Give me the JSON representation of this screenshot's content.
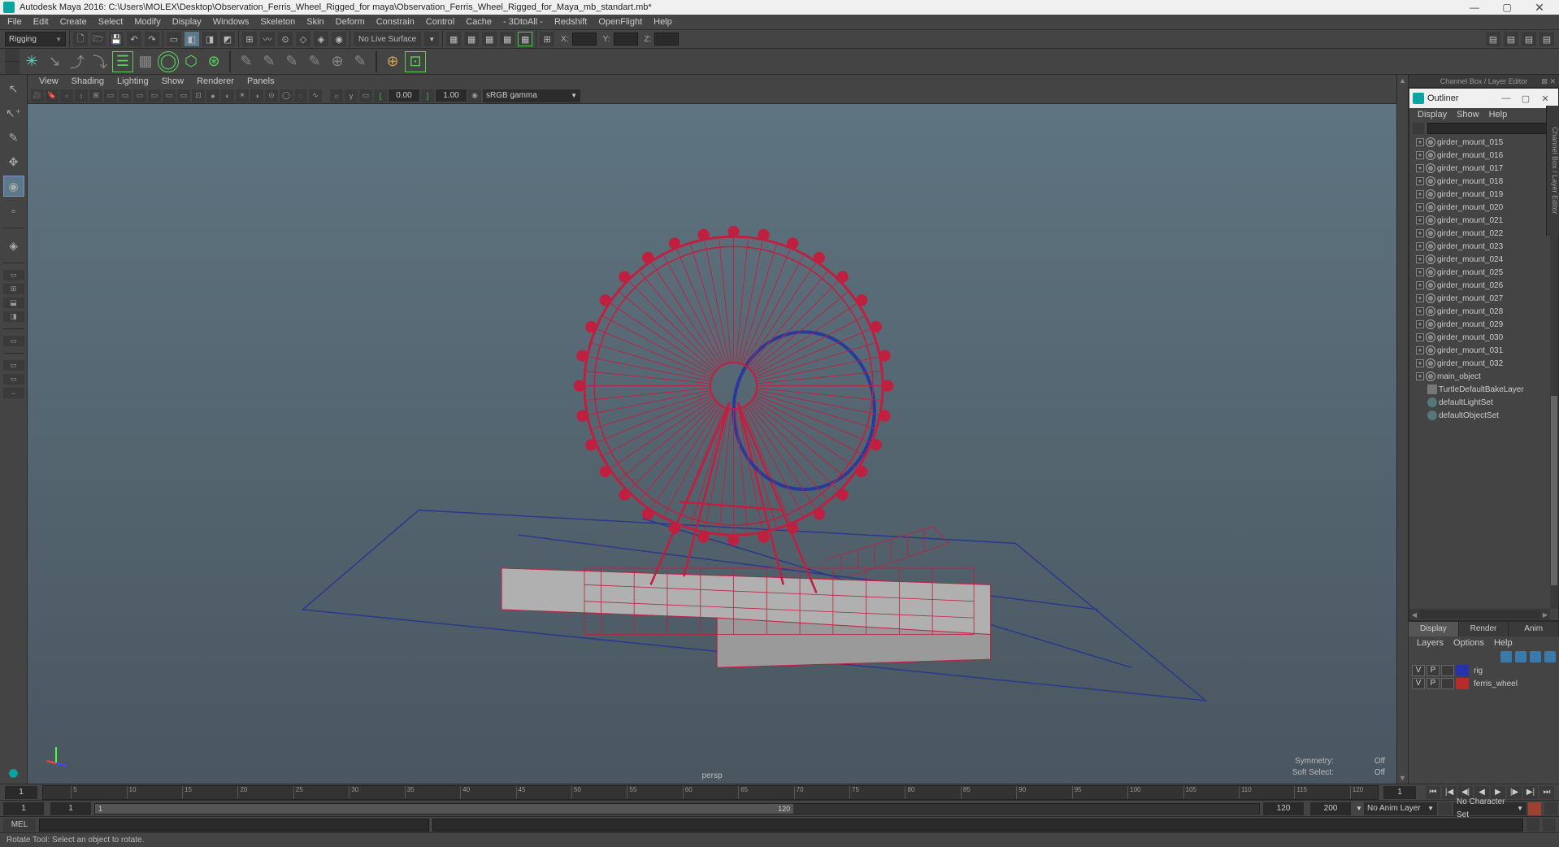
{
  "title": "Autodesk Maya 2016: C:\\Users\\MOLEX\\Desktop\\Observation_Ferris_Wheel_Rigged_for maya\\Observation_Ferris_Wheel_Rigged_for_Maya_mb_standart.mb*",
  "menubar": [
    "File",
    "Edit",
    "Create",
    "Select",
    "Modify",
    "Display",
    "Windows",
    "Skeleton",
    "Skin",
    "Deform",
    "Constrain",
    "Control",
    "Cache",
    "- 3DtoAll -",
    "Redshift",
    "OpenFlight",
    "Help"
  ],
  "shelf_selector": "Rigging",
  "live_surface": "No Live Surface",
  "coords": {
    "x": "X:",
    "y": "Y:",
    "z": "Z:"
  },
  "panel_menu": [
    "View",
    "Shading",
    "Lighting",
    "Show",
    "Renderer",
    "Panels"
  ],
  "panel_vals": {
    "near": "0.00",
    "far": "1.00"
  },
  "color_mgmt": "sRGB gamma",
  "camera_label": "persp",
  "vp_info": {
    "symmetry_lbl": "Symmetry:",
    "symmetry_val": "Off",
    "softsel_lbl": "Soft Select:",
    "softsel_val": "Off"
  },
  "outliner": {
    "title": "Outliner",
    "menus": [
      "Display",
      "Show",
      "Help"
    ],
    "items": [
      "girder_mount_015",
      "girder_mount_016",
      "girder_mount_017",
      "girder_mount_018",
      "girder_mount_019",
      "girder_mount_020",
      "girder_mount_021",
      "girder_mount_022",
      "girder_mount_023",
      "girder_mount_024",
      "girder_mount_025",
      "girder_mount_026",
      "girder_mount_027",
      "girder_mount_028",
      "girder_mount_029",
      "girder_mount_030",
      "girder_mount_031",
      "girder_mount_032",
      "main_object"
    ],
    "extra": [
      "TurtleDefaultBakeLayer",
      "defaultLightSet",
      "defaultObjectSet"
    ]
  },
  "channelbox_tab": "Channel Box / Layer Editor",
  "attr_tab": "Channel Box / Layer Editor",
  "layer_editor": {
    "tabs": [
      "Display",
      "Render",
      "Anim"
    ],
    "menus": [
      "Layers",
      "Options",
      "Help"
    ],
    "rows": [
      {
        "v": "V",
        "p": "P",
        "color": "#2433aa",
        "name": "rig"
      },
      {
        "v": "V",
        "p": "P",
        "color": "#b82b2b",
        "name": "ferris_wheel"
      }
    ]
  },
  "timeslider": {
    "start": "1",
    "end": "1",
    "ticks": [
      "5",
      "10",
      "15",
      "20",
      "25",
      "30",
      "35",
      "40",
      "45",
      "50",
      "55",
      "60",
      "65",
      "70",
      "75",
      "80",
      "85",
      "90",
      "95",
      "100",
      "105",
      "110",
      "115",
      "120"
    ]
  },
  "rangeslider": {
    "f1": "1",
    "f2": "1",
    "thumb_end": "120",
    "r1": "120",
    "r2": "200",
    "anim_layer": "No Anim Layer",
    "char_set": "No Character Set"
  },
  "cmdline": {
    "label": "MEL"
  },
  "helpline": "Rotate Tool: Select an object to rotate."
}
